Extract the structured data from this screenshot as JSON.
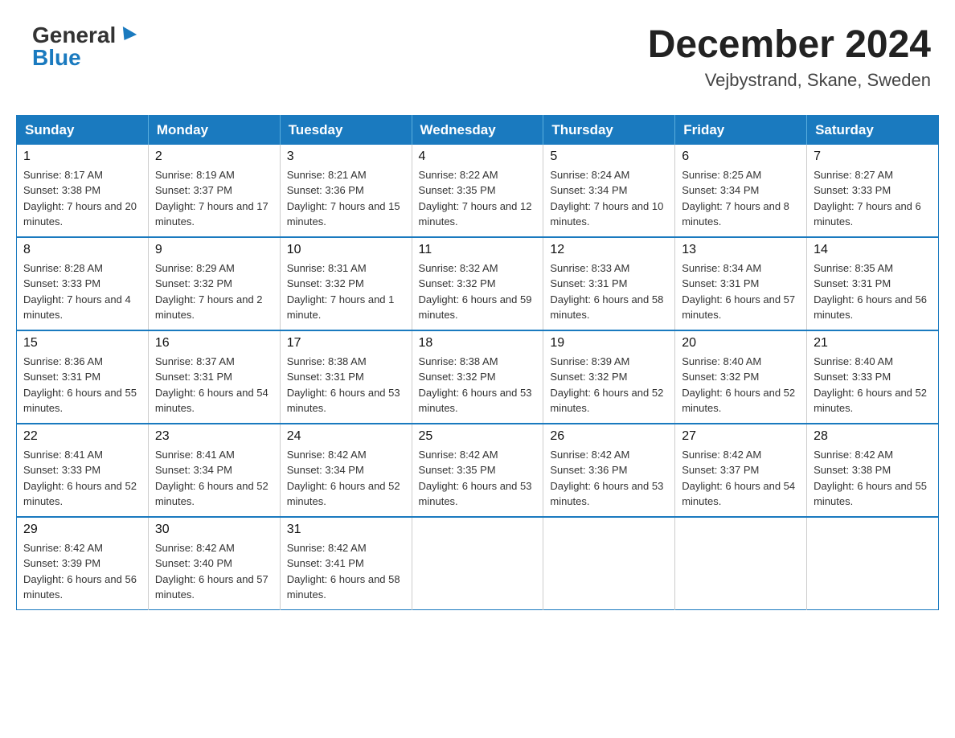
{
  "logo": {
    "general": "General",
    "blue": "Blue"
  },
  "title": "December 2024",
  "location": "Vejbystrand, Skane, Sweden",
  "days_of_week": [
    "Sunday",
    "Monday",
    "Tuesday",
    "Wednesday",
    "Thursday",
    "Friday",
    "Saturday"
  ],
  "weeks": [
    [
      {
        "day": "1",
        "sunrise": "8:17 AM",
        "sunset": "3:38 PM",
        "daylight": "7 hours and 20 minutes."
      },
      {
        "day": "2",
        "sunrise": "8:19 AM",
        "sunset": "3:37 PM",
        "daylight": "7 hours and 17 minutes."
      },
      {
        "day": "3",
        "sunrise": "8:21 AM",
        "sunset": "3:36 PM",
        "daylight": "7 hours and 15 minutes."
      },
      {
        "day": "4",
        "sunrise": "8:22 AM",
        "sunset": "3:35 PM",
        "daylight": "7 hours and 12 minutes."
      },
      {
        "day": "5",
        "sunrise": "8:24 AM",
        "sunset": "3:34 PM",
        "daylight": "7 hours and 10 minutes."
      },
      {
        "day": "6",
        "sunrise": "8:25 AM",
        "sunset": "3:34 PM",
        "daylight": "7 hours and 8 minutes."
      },
      {
        "day": "7",
        "sunrise": "8:27 AM",
        "sunset": "3:33 PM",
        "daylight": "7 hours and 6 minutes."
      }
    ],
    [
      {
        "day": "8",
        "sunrise": "8:28 AM",
        "sunset": "3:33 PM",
        "daylight": "7 hours and 4 minutes."
      },
      {
        "day": "9",
        "sunrise": "8:29 AM",
        "sunset": "3:32 PM",
        "daylight": "7 hours and 2 minutes."
      },
      {
        "day": "10",
        "sunrise": "8:31 AM",
        "sunset": "3:32 PM",
        "daylight": "7 hours and 1 minute."
      },
      {
        "day": "11",
        "sunrise": "8:32 AM",
        "sunset": "3:32 PM",
        "daylight": "6 hours and 59 minutes."
      },
      {
        "day": "12",
        "sunrise": "8:33 AM",
        "sunset": "3:31 PM",
        "daylight": "6 hours and 58 minutes."
      },
      {
        "day": "13",
        "sunrise": "8:34 AM",
        "sunset": "3:31 PM",
        "daylight": "6 hours and 57 minutes."
      },
      {
        "day": "14",
        "sunrise": "8:35 AM",
        "sunset": "3:31 PM",
        "daylight": "6 hours and 56 minutes."
      }
    ],
    [
      {
        "day": "15",
        "sunrise": "8:36 AM",
        "sunset": "3:31 PM",
        "daylight": "6 hours and 55 minutes."
      },
      {
        "day": "16",
        "sunrise": "8:37 AM",
        "sunset": "3:31 PM",
        "daylight": "6 hours and 54 minutes."
      },
      {
        "day": "17",
        "sunrise": "8:38 AM",
        "sunset": "3:31 PM",
        "daylight": "6 hours and 53 minutes."
      },
      {
        "day": "18",
        "sunrise": "8:38 AM",
        "sunset": "3:32 PM",
        "daylight": "6 hours and 53 minutes."
      },
      {
        "day": "19",
        "sunrise": "8:39 AM",
        "sunset": "3:32 PM",
        "daylight": "6 hours and 52 minutes."
      },
      {
        "day": "20",
        "sunrise": "8:40 AM",
        "sunset": "3:32 PM",
        "daylight": "6 hours and 52 minutes."
      },
      {
        "day": "21",
        "sunrise": "8:40 AM",
        "sunset": "3:33 PM",
        "daylight": "6 hours and 52 minutes."
      }
    ],
    [
      {
        "day": "22",
        "sunrise": "8:41 AM",
        "sunset": "3:33 PM",
        "daylight": "6 hours and 52 minutes."
      },
      {
        "day": "23",
        "sunrise": "8:41 AM",
        "sunset": "3:34 PM",
        "daylight": "6 hours and 52 minutes."
      },
      {
        "day": "24",
        "sunrise": "8:42 AM",
        "sunset": "3:34 PM",
        "daylight": "6 hours and 52 minutes."
      },
      {
        "day": "25",
        "sunrise": "8:42 AM",
        "sunset": "3:35 PM",
        "daylight": "6 hours and 53 minutes."
      },
      {
        "day": "26",
        "sunrise": "8:42 AM",
        "sunset": "3:36 PM",
        "daylight": "6 hours and 53 minutes."
      },
      {
        "day": "27",
        "sunrise": "8:42 AM",
        "sunset": "3:37 PM",
        "daylight": "6 hours and 54 minutes."
      },
      {
        "day": "28",
        "sunrise": "8:42 AM",
        "sunset": "3:38 PM",
        "daylight": "6 hours and 55 minutes."
      }
    ],
    [
      {
        "day": "29",
        "sunrise": "8:42 AM",
        "sunset": "3:39 PM",
        "daylight": "6 hours and 56 minutes."
      },
      {
        "day": "30",
        "sunrise": "8:42 AM",
        "sunset": "3:40 PM",
        "daylight": "6 hours and 57 minutes."
      },
      {
        "day": "31",
        "sunrise": "8:42 AM",
        "sunset": "3:41 PM",
        "daylight": "6 hours and 58 minutes."
      },
      null,
      null,
      null,
      null
    ]
  ],
  "labels": {
    "sunrise_prefix": "Sunrise: ",
    "sunset_prefix": "Sunset: ",
    "daylight_prefix": "Daylight: "
  },
  "colors": {
    "header_bg": "#1a7abf",
    "accent": "#1a7abf"
  }
}
